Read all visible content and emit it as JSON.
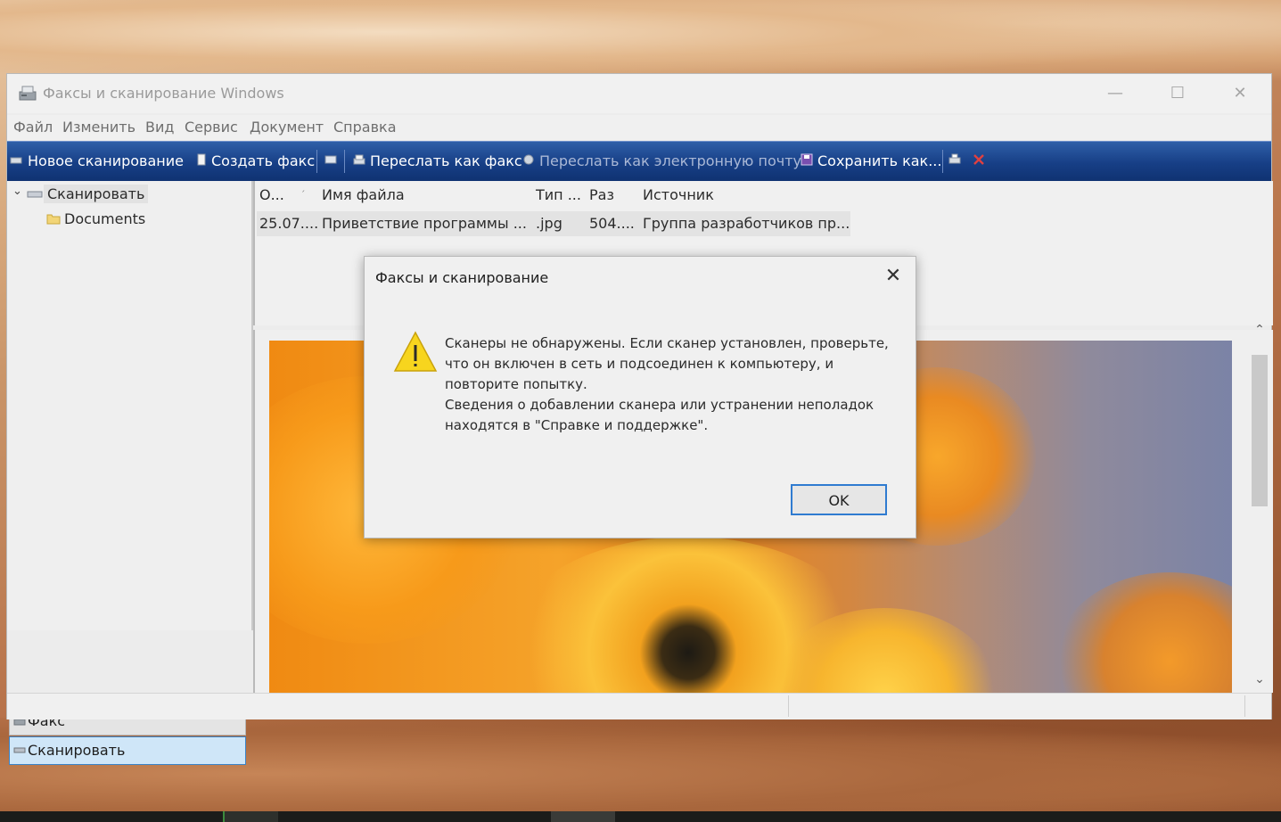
{
  "window": {
    "title": "Факсы и сканирование Windows",
    "controls": {
      "minimize": "—",
      "maximize": "☐",
      "close": "✕"
    }
  },
  "menubar": [
    "Файл",
    "Изменить",
    "Вид",
    "Сервис",
    "Документ",
    "Справка"
  ],
  "toolbar": {
    "new_scan": "Новое сканирование",
    "create_fax": "Создать факс",
    "forward_fax": "Переслать как факс",
    "forward_email": "Переслать как электронную почту",
    "save_as": "Сохранить как..."
  },
  "tree": {
    "root": "Сканировать",
    "child": "Documents"
  },
  "nav": {
    "fax": "Факс",
    "scan": "Сканировать"
  },
  "list": {
    "headers": [
      "О...",
      "Имя файла",
      "Тип ...",
      "Раз",
      "Источник"
    ],
    "rows": [
      [
        "25.07....",
        "Приветствие программы ...",
        ".jpg",
        "504....",
        "Группа разработчиков пр..."
      ]
    ]
  },
  "dialog": {
    "title": "Факсы и сканирование",
    "close": "✕",
    "message_1": "Сканеры не обнаружены. Если сканер установлен, проверьте, что он включен в сеть и подсоединен к компьютеру, и повторите попытку.",
    "message_2": "Сведения о добавлении сканера или устранении неполадок находятся в \"Справке и поддержке\".",
    "ok": "OK"
  },
  "colors": {
    "toolbar": "#173f86",
    "ok_border": "#2f7bd0",
    "nav_active": "#cfe6f8"
  }
}
